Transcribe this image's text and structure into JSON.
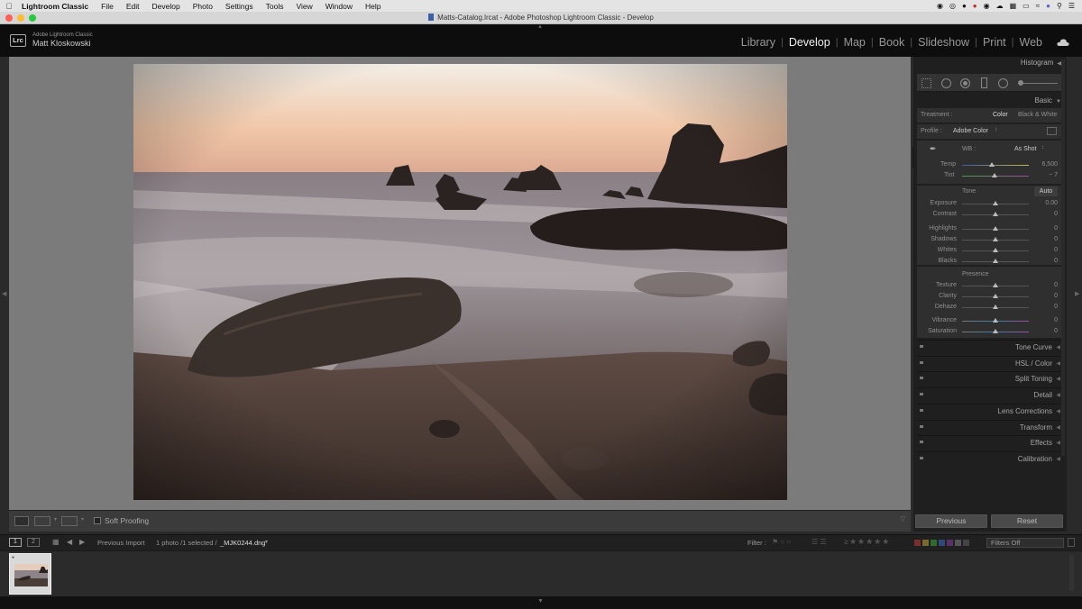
{
  "menubar": {
    "app_name": "Lightroom Classic",
    "items": [
      "File",
      "Edit",
      "Develop",
      "Photo",
      "Settings",
      "Tools",
      "View",
      "Window",
      "Help"
    ]
  },
  "window": {
    "title": "Matts-Catalog.lrcat - Adobe Photoshop Lightroom Classic - Develop"
  },
  "identity": {
    "logo": "Lrc",
    "product": "Adobe Lightroom Classic",
    "user": "Matt Kloskowski"
  },
  "modules": {
    "items": [
      "Library",
      "Develop",
      "Map",
      "Book",
      "Slideshow",
      "Print",
      "Web"
    ],
    "active": "Develop"
  },
  "toolbar": {
    "soft_proofing": "Soft Proofing"
  },
  "right_panel": {
    "histogram": "Histogram",
    "basic": "Basic",
    "treatment_label": "Treatment :",
    "treatment_color": "Color",
    "treatment_bw": "Black & White",
    "profile_label": "Profile :",
    "profile_value": "Adobe Color",
    "wb_label": "WB :",
    "wb_value": "As Shot",
    "temp": {
      "label": "Temp",
      "value": "6,500",
      "level": 0.45
    },
    "tint": {
      "label": "Tint",
      "value": "− 7",
      "level": 0.49
    },
    "tone_label": "Tone",
    "auto_label": "Auto",
    "tone_sliders": [
      {
        "label": "Exposure",
        "value": "0.00",
        "level": 0.5
      },
      {
        "label": "Contrast",
        "value": "0",
        "level": 0.5
      },
      {
        "label": "Highlights",
        "value": "0",
        "level": 0.5
      },
      {
        "label": "Shadows",
        "value": "0",
        "level": 0.5
      },
      {
        "label": "Whites",
        "value": "0",
        "level": 0.5
      },
      {
        "label": "Blacks",
        "value": "0",
        "level": 0.5
      }
    ],
    "presence_label": "Presence",
    "presence_sliders": [
      {
        "label": "Texture",
        "value": "0",
        "level": 0.5
      },
      {
        "label": "Clarity",
        "value": "0",
        "level": 0.5
      },
      {
        "label": "Dehaze",
        "value": "0",
        "level": 0.5
      },
      {
        "label": "Vibrance",
        "value": "0",
        "level": 0.5
      },
      {
        "label": "Saturation",
        "value": "0",
        "level": 0.5
      }
    ],
    "collapsed_panels": [
      "Tone Curve",
      "HSL / Color",
      "Split Toning",
      "Detail",
      "Lens Corrections",
      "Transform",
      "Effects",
      "Calibration"
    ],
    "previous_button": "Previous",
    "reset_button": "Reset"
  },
  "filmstrip": {
    "page1": "1",
    "page2": "2",
    "source": "Previous Import",
    "selection": "1 photo /1 selected /",
    "filename": "_MJK0244.dng",
    "filter_label": "Filter :",
    "filters_off": "Filters Off"
  },
  "colors": {
    "accent_active": "#f0f0f0",
    "panel_bg": "#1f1f1f",
    "viewer_bg": "#7b7b7b"
  }
}
